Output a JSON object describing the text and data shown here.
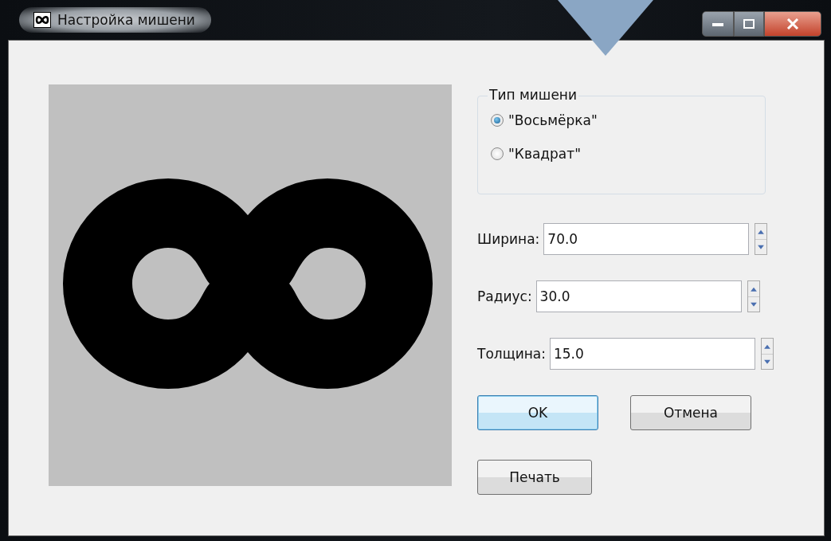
{
  "window": {
    "title": "Настройка мишени"
  },
  "target_type": {
    "title": "Тип мишени",
    "options": [
      {
        "label": "\"Восьмёрка\"",
        "selected": true
      },
      {
        "label": "\"Квадрат\"",
        "selected": false
      }
    ]
  },
  "fields": [
    {
      "label": "Ширина:",
      "value": "70.0"
    },
    {
      "label": "Радиус:",
      "value": "30.0"
    },
    {
      "label": "Толщина:",
      "value": "15.0"
    }
  ],
  "buttons": [
    {
      "label": "OK",
      "default": true
    },
    {
      "label": "Отмена",
      "default": false
    }
  ],
  "print_button": {
    "label": "Печать"
  }
}
